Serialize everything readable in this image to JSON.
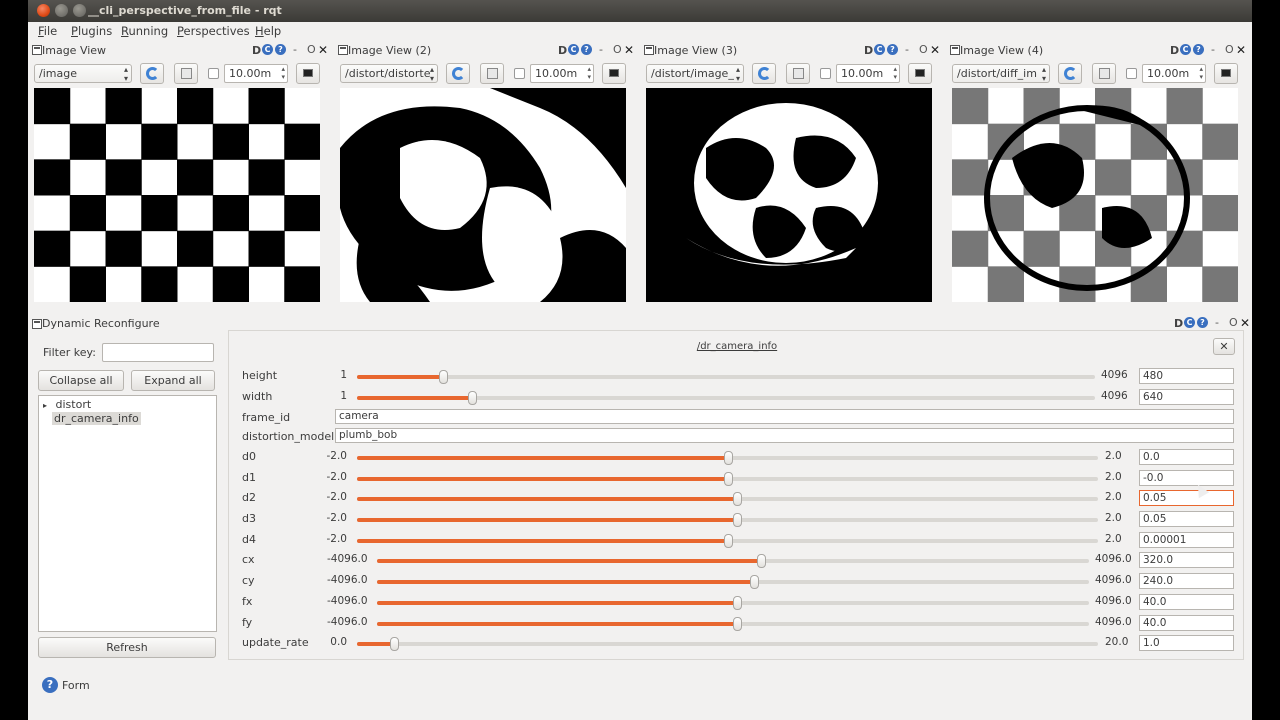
{
  "window": {
    "title": "__cli_perspective_from_file - rqt"
  },
  "menu": [
    "File",
    "Plugins",
    "Running",
    "Perspectives",
    "Help"
  ],
  "image_views": [
    {
      "title": "Image View",
      "topic": "/image",
      "zoom": "10.00m"
    },
    {
      "title": "Image View (2)",
      "topic": "/distort/distorte",
      "zoom": "10.00m"
    },
    {
      "title": "Image View (3)",
      "topic": "/distort/image_",
      "zoom": "10.00m"
    },
    {
      "title": "Image View (4)",
      "topic": "/distort/diff_im",
      "zoom": "10.00m"
    }
  ],
  "dock_controls": {
    "dc": "D",
    "c": "C",
    "help": "?",
    "min": "-",
    "float": "O",
    "close": "✕"
  },
  "dynamic_reconfigure": {
    "title": "Dynamic Reconfigure",
    "filter_label": "Filter key:",
    "filter_value": "",
    "collapse_all": "Collapse all",
    "expand_all": "Expand all",
    "tree": [
      {
        "label": "distort",
        "arrow": "▸"
      },
      {
        "label": "dr_camera_info"
      }
    ],
    "refresh": "Refresh",
    "panel_title": "/dr_camera_info",
    "panel_close": "✕",
    "params": [
      {
        "name": "height",
        "min": "1",
        "max": "4096",
        "value": "480",
        "frac": 0.117
      },
      {
        "name": "width",
        "min": "1",
        "max": "4096",
        "value": "640",
        "frac": 0.156
      },
      {
        "name": "frame_id",
        "text": "camera"
      },
      {
        "name": "distortion_model",
        "text": "plumb_bob"
      },
      {
        "name": "d0",
        "min": "-2.0",
        "max": "2.0",
        "value": "0.0",
        "frac": 0.5
      },
      {
        "name": "d1",
        "min": "-2.0",
        "max": "2.0",
        "value": "-0.0",
        "frac": 0.5
      },
      {
        "name": "d2",
        "min": "-2.0",
        "max": "2.0",
        "value": "0.05",
        "frac": 0.5125,
        "focus": true
      },
      {
        "name": "d3",
        "min": "-2.0",
        "max": "2.0",
        "value": "0.05",
        "frac": 0.5125
      },
      {
        "name": "d4",
        "min": "-2.0",
        "max": "2.0",
        "value": "0.00001",
        "frac": 0.5
      },
      {
        "name": "cx",
        "min": "-4096.0",
        "max": "4096.0",
        "value": "320.0",
        "frac": 0.539
      },
      {
        "name": "cy",
        "min": "-4096.0",
        "max": "4096.0",
        "value": "240.0",
        "frac": 0.529
      },
      {
        "name": "fx",
        "min": "-4096.0",
        "max": "4096.0",
        "value": "40.0",
        "frac": 0.505
      },
      {
        "name": "fy",
        "min": "-4096.0",
        "max": "4096.0",
        "value": "40.0",
        "frac": 0.505
      },
      {
        "name": "update_rate",
        "min": "0.0",
        "max": "20.0",
        "value": "1.0",
        "frac": 0.05
      }
    ]
  },
  "footer": {
    "help": "?",
    "label": "Form"
  }
}
